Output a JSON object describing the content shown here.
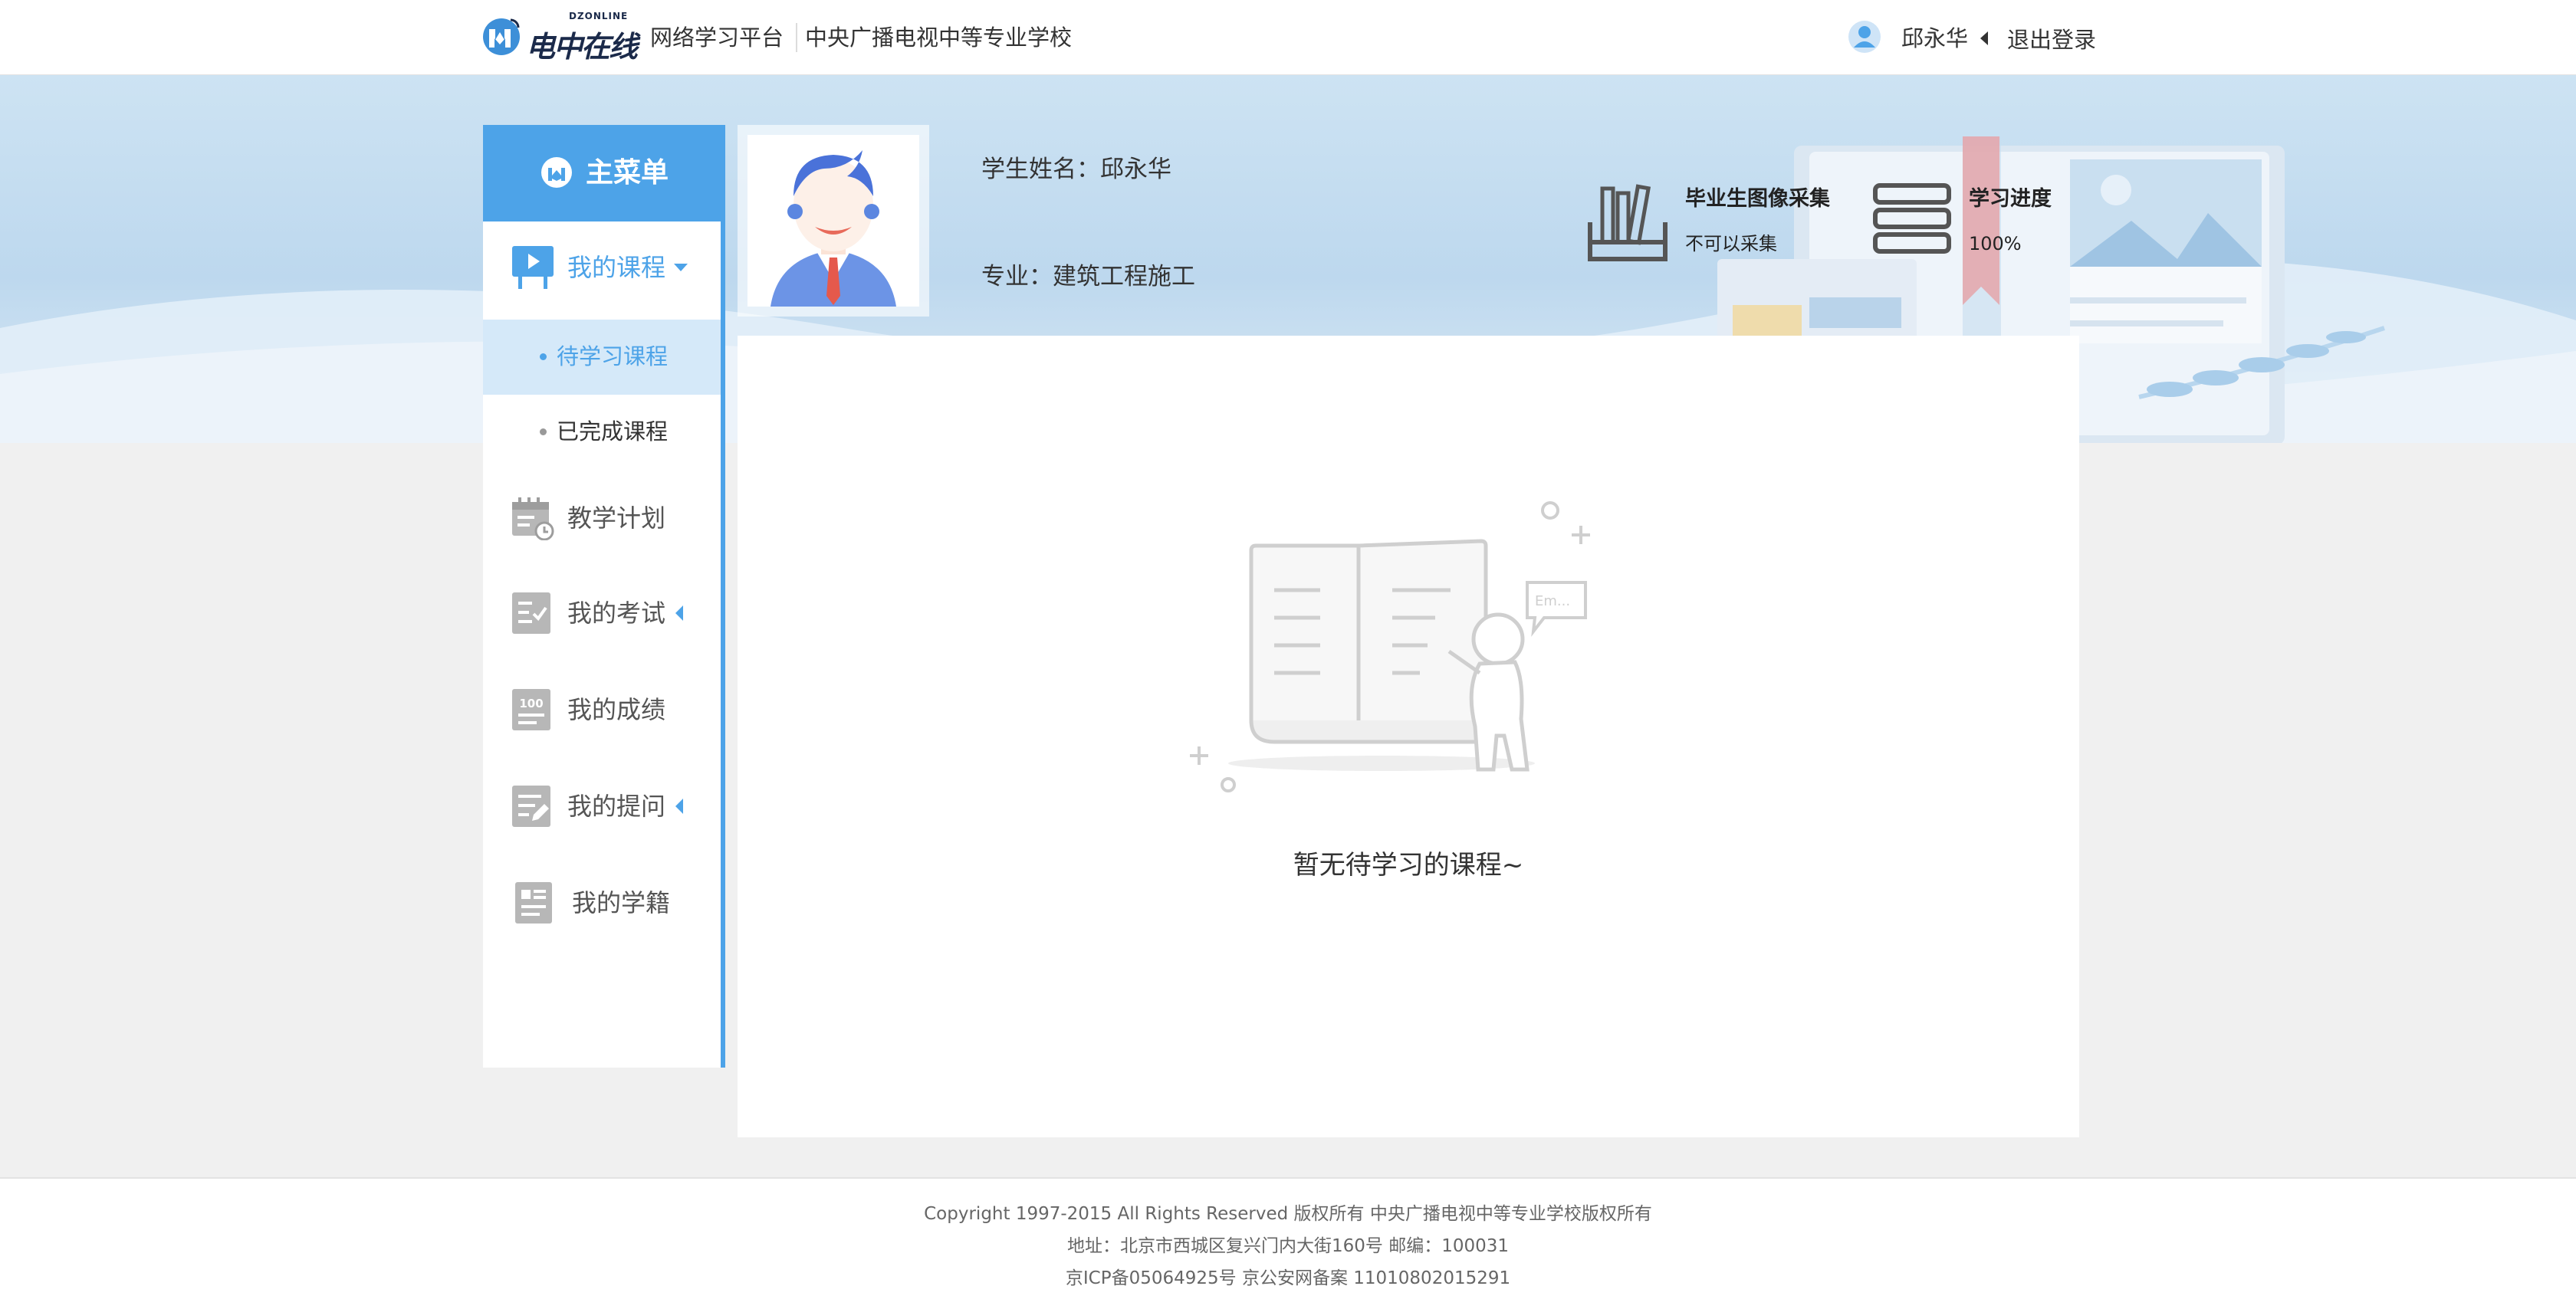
{
  "header": {
    "logo_latin": "DZONLINE",
    "logo_text": "电中在线",
    "platform": "网络学习平台",
    "school": "中央广播电视中等专业学校",
    "username": "邱永华",
    "logout": "退出登录"
  },
  "menu": {
    "title": "主菜单",
    "items": [
      {
        "label": "我的课程",
        "icon": "play-board-icon",
        "expanded": true
      },
      {
        "label": "教学计划",
        "icon": "calendar-clock-icon"
      },
      {
        "label": "我的考试",
        "icon": "exam-checklist-icon"
      },
      {
        "label": "我的成绩",
        "icon": "score-100-icon"
      },
      {
        "label": "我的提问",
        "icon": "question-edit-icon"
      },
      {
        "label": "我的学籍",
        "icon": "student-record-icon"
      }
    ],
    "sub_items": [
      {
        "label": "待学习课程",
        "active": true
      },
      {
        "label": "已完成课程",
        "active": false
      }
    ],
    "accent": "#4da3e8"
  },
  "profile": {
    "name_line": "学生姓名：邱永华",
    "major_line": "专业：建筑工程施工",
    "stats": [
      {
        "title": "毕业生图像采集",
        "value": "不可以采集",
        "icon": "books-box-icon"
      },
      {
        "title": "学习进度",
        "value": "100%",
        "icon": "book-stack-bookmark-icon"
      }
    ]
  },
  "content": {
    "empty_message": "暂无待学习的课程~",
    "bubble_text": "Em..."
  },
  "footer": {
    "copyright": "Copyright 1997-2015 All Rights Reserved 版权所有 中央广播电视中等专业学校版权所有",
    "address": "地址：北京市西城区复兴门内大街160号 邮编：100031",
    "icp": "京ICP备05064925号 京公安网备案 11010802015291"
  }
}
